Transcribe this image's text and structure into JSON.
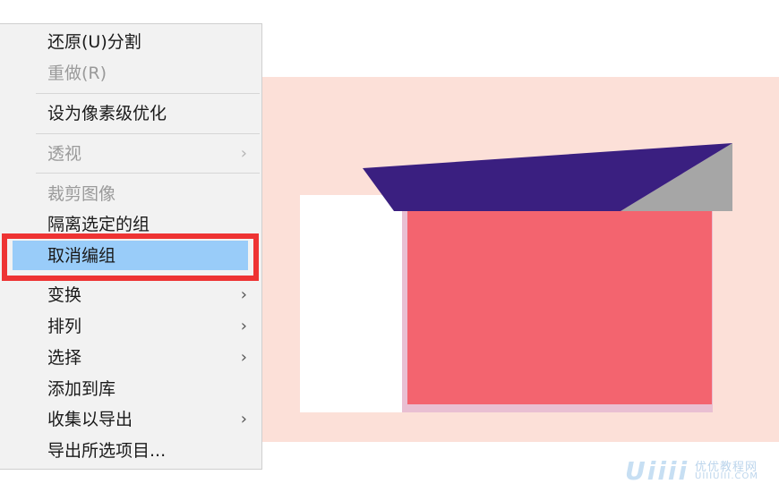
{
  "context_menu": {
    "items": [
      {
        "label": "还原(U)分割",
        "enabled": true,
        "submenu": false
      },
      {
        "label": "重做(R)",
        "enabled": false,
        "submenu": false
      },
      {
        "label": "设为像素级优化",
        "enabled": true,
        "submenu": false
      },
      {
        "label": "透视",
        "enabled": false,
        "submenu": true
      },
      {
        "label": "裁剪图像",
        "enabled": false,
        "submenu": false
      },
      {
        "label": "隔离选定的组",
        "enabled": true,
        "submenu": false
      },
      {
        "label": "取消编组",
        "enabled": true,
        "submenu": false,
        "highlighted": true
      },
      {
        "label": "变换",
        "enabled": true,
        "submenu": true
      },
      {
        "label": "排列",
        "enabled": true,
        "submenu": true
      },
      {
        "label": "选择",
        "enabled": true,
        "submenu": true
      },
      {
        "label": "添加到库",
        "enabled": true,
        "submenu": false
      },
      {
        "label": "收集以导出",
        "enabled": true,
        "submenu": true
      },
      {
        "label": "导出所选项目...",
        "enabled": true,
        "submenu": false
      }
    ],
    "submenu_arrow": "›",
    "highlight_color": "#ee3333",
    "hover_color": "#99ccf9"
  },
  "artwork": {
    "artboard_color": "#fce0d8",
    "roof_color": "#3a1f80",
    "roof_side_color": "#a6a6a6",
    "red_block_color": "#f3646f",
    "white_block_color": "#ffffff"
  },
  "watermark": {
    "logo": "Uiiii",
    "site_name": "优优教程网",
    "url": "UIIIUIII.COM"
  }
}
